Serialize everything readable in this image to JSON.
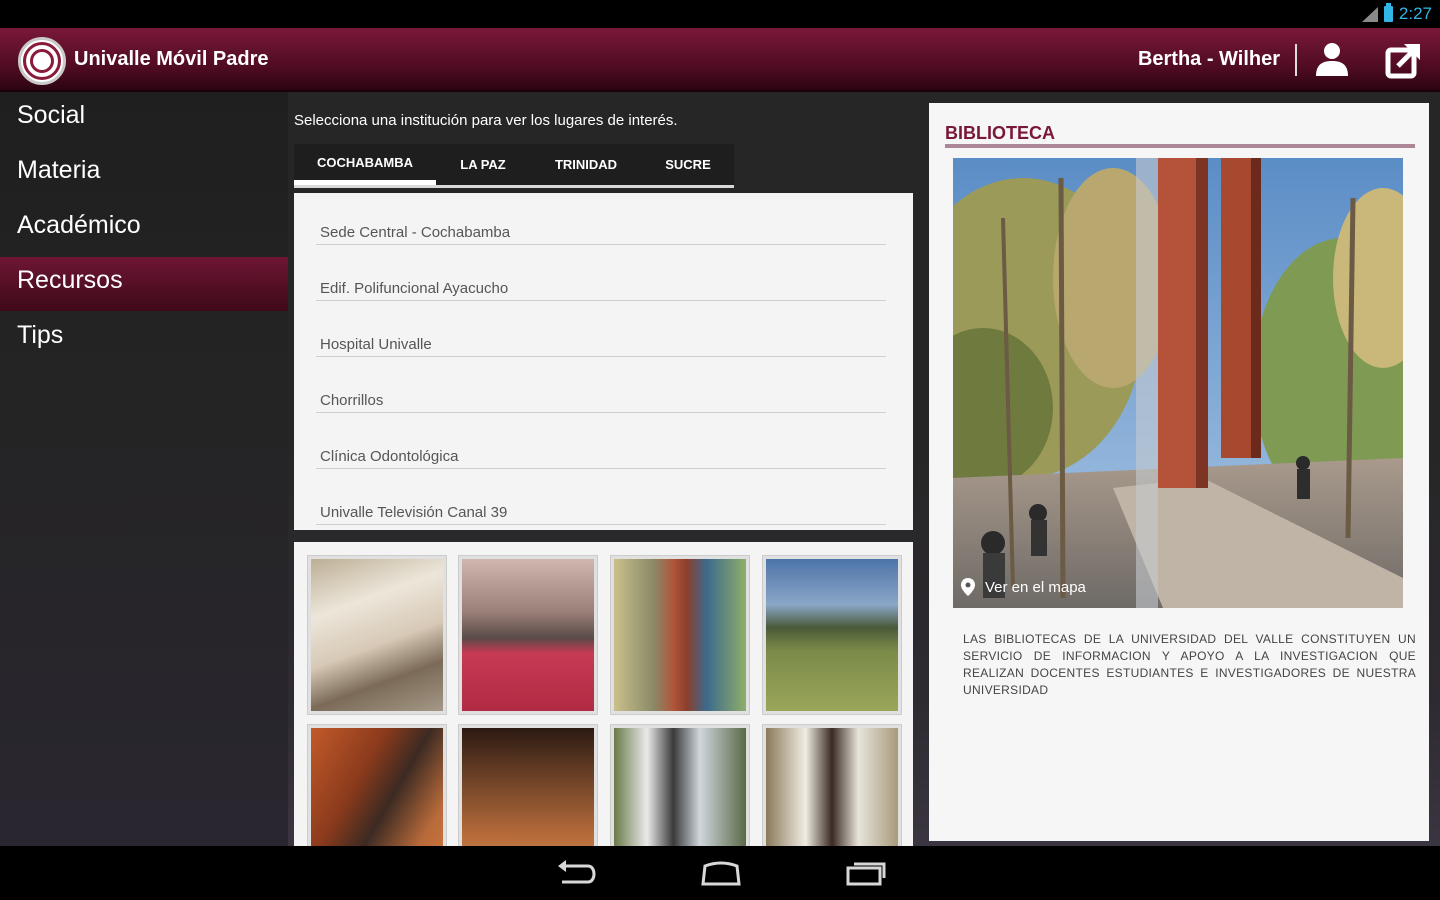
{
  "status_bar": {
    "time": "2:27"
  },
  "app": {
    "title": "Univalle Móvil Padre",
    "user": "Bertha  - Wilher"
  },
  "sidebar": {
    "items": [
      {
        "label": "Social"
      },
      {
        "label": "Materia"
      },
      {
        "label": "Académico"
      },
      {
        "label": "Recursos",
        "active": true
      },
      {
        "label": "Tips"
      }
    ]
  },
  "main": {
    "instruction": "Selecciona una institución para ver los lugares de interés.",
    "tabs": [
      {
        "label": "COCHABAMBA",
        "active": true
      },
      {
        "label": "LA PAZ"
      },
      {
        "label": "TRINIDAD"
      },
      {
        "label": "SUCRE"
      }
    ],
    "places": [
      "Sede Central - Cochabamba",
      "Edif. Polifuncional Ayacucho",
      "Hospital Univalle",
      "Chorrillos",
      "Clínica Odontológica",
      "Univalle Televisión Canal 39"
    ],
    "gallery_count": 8
  },
  "detail": {
    "title": "BIBLIOTECA",
    "map_link": "Ver en el mapa",
    "description": "LAS BIBLIOTECAS DE LA UNIVERSIDAD DEL VALLE CONSTITUYEN UN SERVICIO DE INFORMACION Y APOYO A LA INVESTIGACION QUE REALIZAN DOCENTES ESTUDIANTES E INVESTIGADORES DE NUESTRA UNIVERSIDAD"
  },
  "colors": {
    "brand": "#7a1838",
    "status_accent": "#33b5e5"
  },
  "icons": [
    "wifi-signal-icon",
    "battery-icon",
    "univalle-logo",
    "person-icon",
    "exit-app-icon",
    "location-pin-icon",
    "back-icon",
    "home-icon",
    "recent-apps-icon"
  ]
}
